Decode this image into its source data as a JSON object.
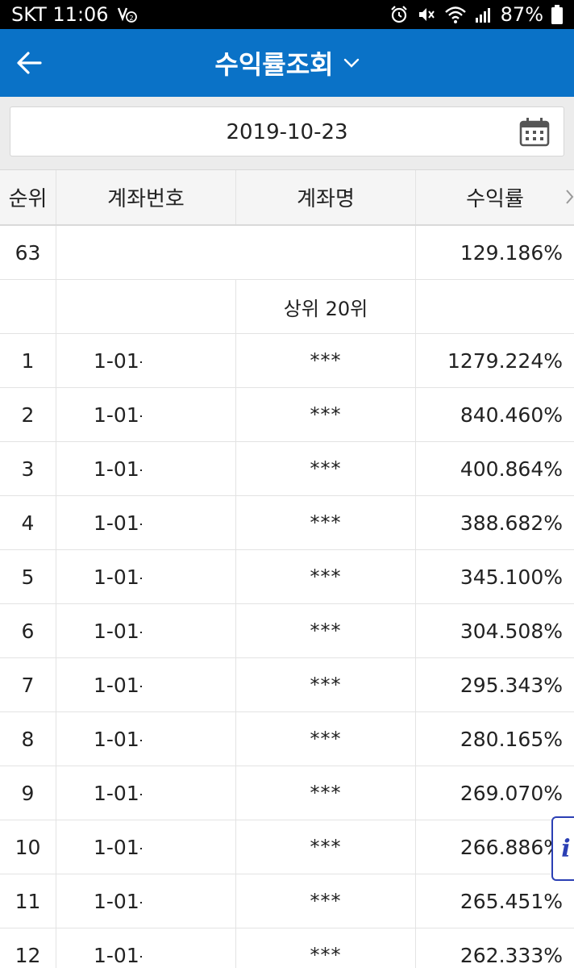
{
  "status_bar": {
    "carrier_time": "SKT 11:06",
    "battery": "87%",
    "icons": [
      "volte-icon",
      "alarm-icon",
      "mute-icon",
      "wifi-icon",
      "signal-icon",
      "battery-icon"
    ]
  },
  "header": {
    "title": "수익률조회",
    "back_icon": "arrow-left-icon",
    "dropdown_icon": "chevron-down-icon"
  },
  "date_field": {
    "value": "2019-10-23",
    "icon": "calendar-icon"
  },
  "table": {
    "columns": [
      "순위",
      "계좌번호",
      "계좌명",
      "수익률"
    ],
    "more_icon": "chevron-right-icon",
    "my_row": {
      "rank": "63",
      "account": "",
      "name": "",
      "rate": "129.186%"
    },
    "section_label": "상위 20위",
    "rows": [
      {
        "rank": "1",
        "account": "1-01-",
        "name": "***",
        "rate": "1279.224%"
      },
      {
        "rank": "2",
        "account": "1-01-",
        "name": "***",
        "rate": "840.460%"
      },
      {
        "rank": "3",
        "account": "1-01-",
        "name": "***",
        "rate": "400.864%"
      },
      {
        "rank": "4",
        "account": "1-01-",
        "name": "***",
        "rate": "388.682%"
      },
      {
        "rank": "5",
        "account": "1-01-",
        "name": "***",
        "rate": "345.100%"
      },
      {
        "rank": "6",
        "account": "1-01-",
        "name": "***",
        "rate": "304.508%"
      },
      {
        "rank": "7",
        "account": "1-01-",
        "name": "***",
        "rate": "295.343%"
      },
      {
        "rank": "8",
        "account": "1-01-",
        "name": "***",
        "rate": "280.165%"
      },
      {
        "rank": "9",
        "account": "1-01-",
        "name": "***",
        "rate": "269.070%"
      },
      {
        "rank": "10",
        "account": "1-01-",
        "name": "***",
        "rate": "266.886%"
      },
      {
        "rank": "11",
        "account": "1-01-",
        "name": "***",
        "rate": "265.451%"
      },
      {
        "rank": "12",
        "account": "1-01-",
        "name": "***",
        "rate": "262.333%"
      }
    ]
  },
  "info_button": {
    "label": "i"
  },
  "colors": {
    "header_bg": "#0a72c7",
    "info_border": "#2b3fb4"
  }
}
